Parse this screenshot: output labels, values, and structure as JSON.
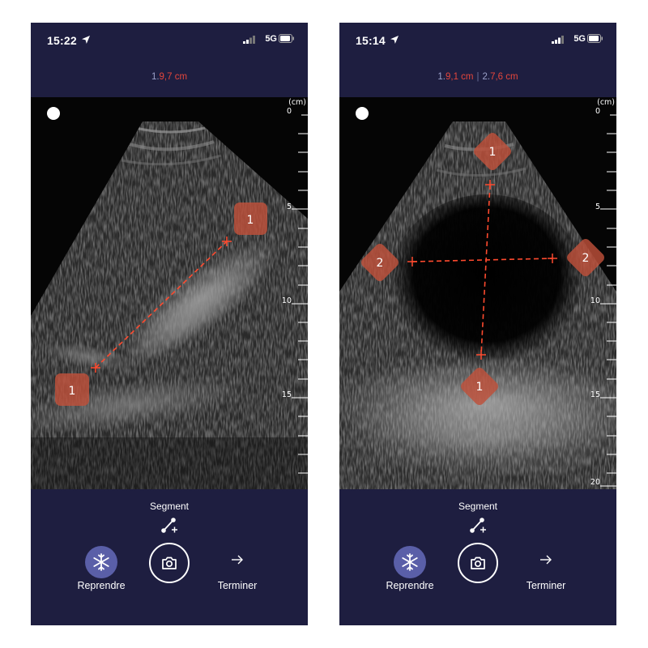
{
  "phones": [
    {
      "status": {
        "time": "15:22",
        "network": "5G"
      },
      "measurements": [
        {
          "index": "1.",
          "value": "9,7 cm"
        }
      ],
      "scale": {
        "unit": "(cm)",
        "ticks": [
          "0",
          "5",
          "10",
          "15"
        ]
      },
      "markers": [
        "1",
        "1"
      ],
      "toolbar": {
        "mode": "Segment",
        "freeze_label": "Reprendre",
        "finish_label": "Terminer"
      }
    },
    {
      "status": {
        "time": "15:14",
        "network": "5G"
      },
      "measurements": [
        {
          "index": "1.",
          "value": "9,1 cm"
        },
        {
          "index": "2.",
          "value": "7,6 cm"
        }
      ],
      "scale": {
        "unit": "(cm)",
        "ticks": [
          "0",
          "5",
          "10",
          "15",
          "20"
        ]
      },
      "markers": [
        "1",
        "1",
        "2",
        "2"
      ],
      "toolbar": {
        "mode": "Segment",
        "freeze_label": "Reprendre",
        "finish_label": "Terminer"
      }
    }
  ],
  "colors": {
    "background": "#1e1e40",
    "measure": "#e4463c",
    "marker": "#c0503a",
    "accent": "#5a5fa8"
  },
  "icons": [
    "location-arrow-icon",
    "signal-icon",
    "battery-icon",
    "segment-tool-icon",
    "snowflake-icon",
    "camera-icon",
    "arrow-right-icon"
  ]
}
